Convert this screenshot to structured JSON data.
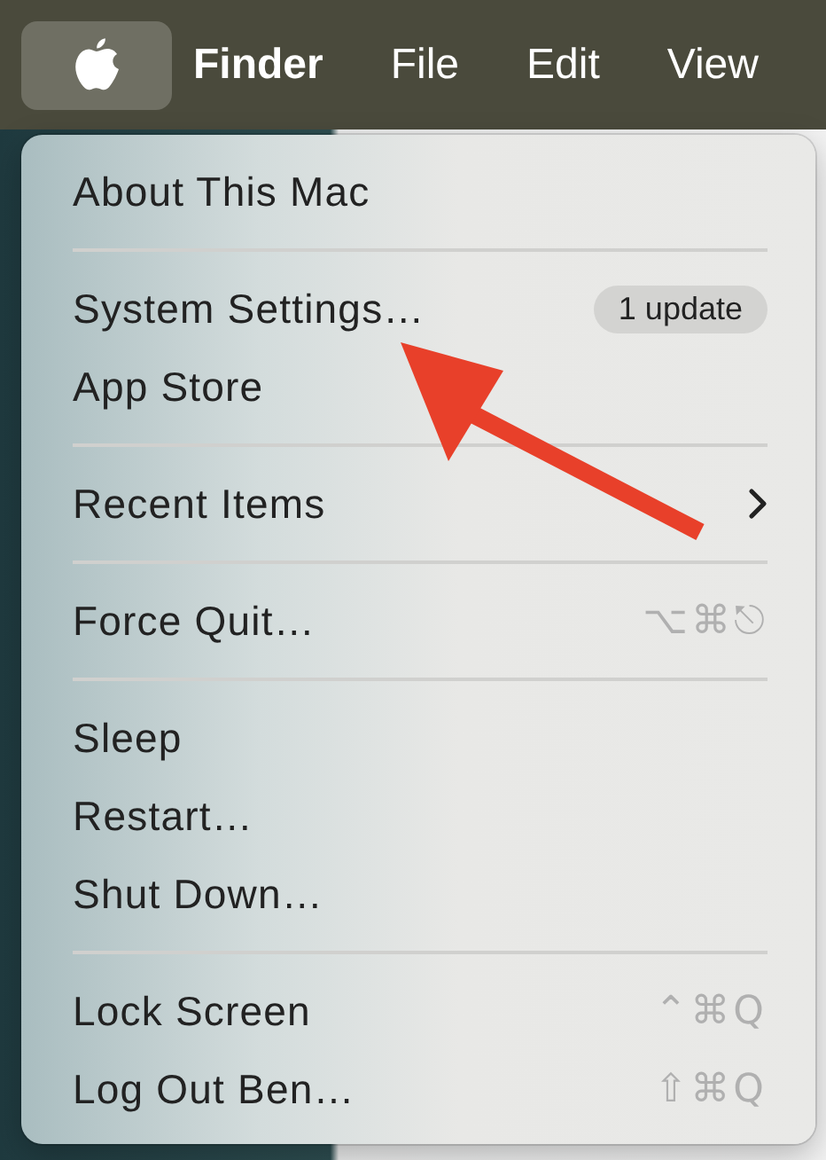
{
  "menu_bar": {
    "apple_selected": true,
    "items": [
      {
        "label": "Finder",
        "bold": true
      },
      {
        "label": "File",
        "bold": false
      },
      {
        "label": "Edit",
        "bold": false
      },
      {
        "label": "View",
        "bold": false
      }
    ]
  },
  "menu": {
    "sections": [
      [
        {
          "kind": "plain",
          "label": "About This Mac"
        }
      ],
      [
        {
          "kind": "badge",
          "label": "System Settings…",
          "badge": "1 update"
        },
        {
          "kind": "plain",
          "label": "App Store"
        }
      ],
      [
        {
          "kind": "submenu",
          "label": "Recent Items"
        }
      ],
      [
        {
          "kind": "shortcut",
          "label": "Force Quit…",
          "shortcut": "⌥⌘⎋"
        }
      ],
      [
        {
          "kind": "plain",
          "label": "Sleep"
        },
        {
          "kind": "plain",
          "label": "Restart…"
        },
        {
          "kind": "plain",
          "label": "Shut Down…"
        }
      ],
      [
        {
          "kind": "shortcut",
          "label": "Lock Screen",
          "shortcut": "⌃⌘Q"
        },
        {
          "kind": "shortcut",
          "label": "Log Out Ben…",
          "shortcut": "⇧⌘Q"
        }
      ]
    ]
  }
}
